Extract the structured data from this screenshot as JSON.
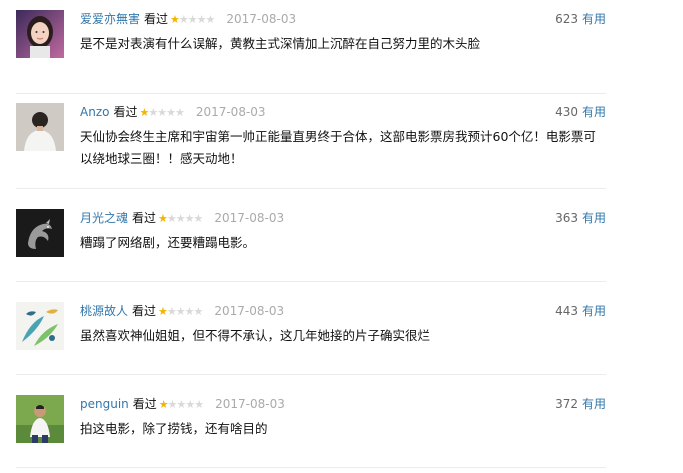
{
  "comments": [
    {
      "user": "爱爱亦無害",
      "status": "看过",
      "rating": 1,
      "date": "2017-08-03",
      "votes": "623",
      "useful_label": "有用",
      "text": "是不是对表演有什么误解，黄教主式深情加上沉醉在自己努力里的木头脸",
      "avatar_icon": "woman-portrait-icon"
    },
    {
      "user": "Anzo",
      "status": "看过",
      "rating": 1,
      "date": "2017-08-03",
      "votes": "430",
      "useful_label": "有用",
      "text": "天仙协会终生主席和宇宙第一帅正能量直男终于合体，这部电影票房我预计60个亿！电影票可以绕地球三圈！！感天动地！",
      "avatar_icon": "man-back-icon"
    },
    {
      "user": "月光之魂",
      "status": "看过",
      "rating": 1,
      "date": "2017-08-03",
      "votes": "363",
      "useful_label": "有用",
      "text": "糟蹋了网络剧，还要糟蹋电影。",
      "avatar_icon": "dragon-icon"
    },
    {
      "user": "桃源故人",
      "status": "看过",
      "rating": 1,
      "date": "2017-08-03",
      "votes": "443",
      "useful_label": "有用",
      "text": "虽然喜欢神仙姐姐，但不得不承认，这几年她接的片子确实很烂",
      "avatar_icon": "leaf-art-icon"
    },
    {
      "user": "penguin",
      "status": "看过",
      "rating": 1,
      "date": "2017-08-03",
      "votes": "372",
      "useful_label": "有用",
      "text": "拍这电影，除了捞钱，还有啥目的",
      "avatar_icon": "man-outdoor-icon"
    }
  ],
  "colors": {
    "link": "#3377aa",
    "star": "#f4b400",
    "date": "#aaaaaa",
    "divider": "#ececec"
  }
}
